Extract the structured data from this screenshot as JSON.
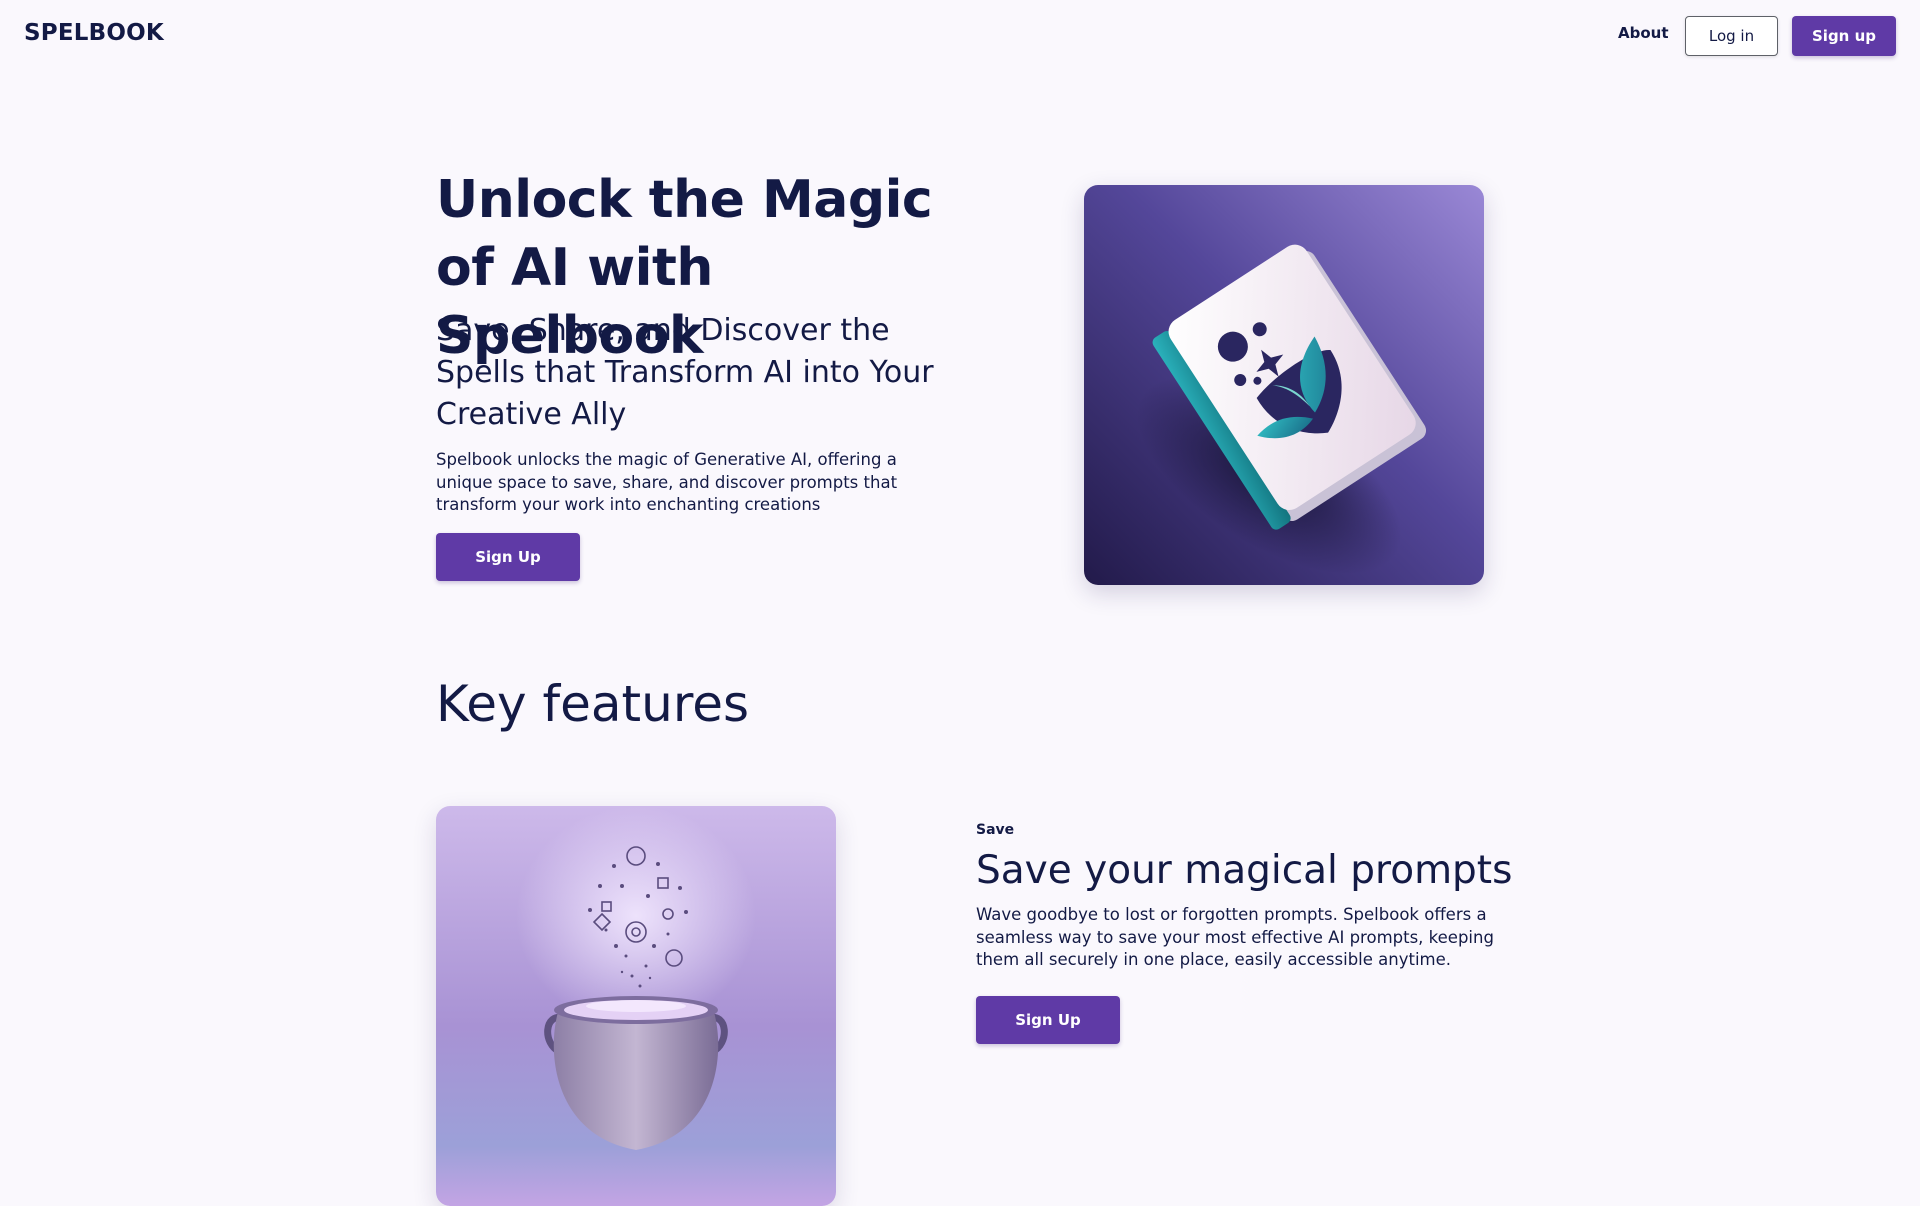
{
  "header": {
    "logo": "SPELBOOK",
    "nav_about": "About",
    "login_label": "Log in",
    "signup_label": "Sign up"
  },
  "hero": {
    "title": "Unlock the Magic of AI with Spelbook",
    "subtitle": "Save, Share, and Discover the Spells that Transform AI into Your Creative Ally",
    "description": "Spelbook unlocks the magic of Generative AI, offering a unique space to save, share, and discover prompts that transform your work into enchanting creations",
    "cta_label": "Sign Up",
    "image_icon": "spellbook-illustration"
  },
  "features": {
    "title": "Key features",
    "items": [
      {
        "tag": "Save",
        "title": "Save your magical prompts",
        "description": "Wave goodbye to lost or forgotten prompts. Spelbook offers a seamless way to save your most effective AI prompts, keeping them all securely in one place, easily accessible anytime.",
        "cta_label": "Sign Up",
        "image_icon": "cauldron-illustration"
      }
    ]
  },
  "colors": {
    "background": "#faf8fd",
    "text": "#131a45",
    "accent": "#5f3aa6"
  }
}
